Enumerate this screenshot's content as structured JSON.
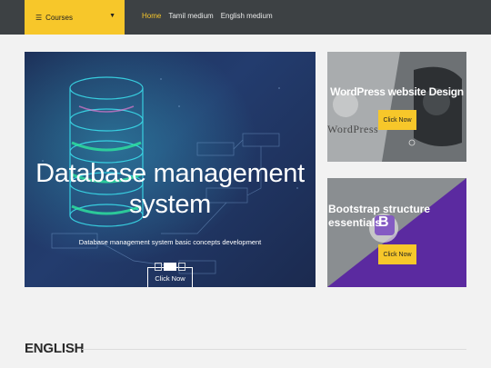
{
  "header": {
    "courses_label": "Courses",
    "nav": [
      {
        "label": "Home",
        "active": true
      },
      {
        "label": "Tamil medium",
        "active": false
      },
      {
        "label": "English medium",
        "active": false
      }
    ]
  },
  "hero": {
    "title_line1": "Database management",
    "title_line2": "system",
    "subtitle": "Database management system basic concepts development",
    "button": "Click Now",
    "slides": [
      {
        "active": false
      },
      {
        "active": true
      },
      {
        "active": false
      }
    ]
  },
  "cards": [
    {
      "title": "WordPress website Design",
      "button": "Click Now",
      "logo_text": "WordPress"
    },
    {
      "title": "Bootstrap structure essentials",
      "button": "Click Now",
      "logo_letter": "B"
    }
  ],
  "section": {
    "title": "ENGLISH"
  },
  "colors": {
    "accent": "#f7c72a",
    "topbar": "#3d4144",
    "purple": "#5b2aa0",
    "hero": "#1d3059"
  }
}
